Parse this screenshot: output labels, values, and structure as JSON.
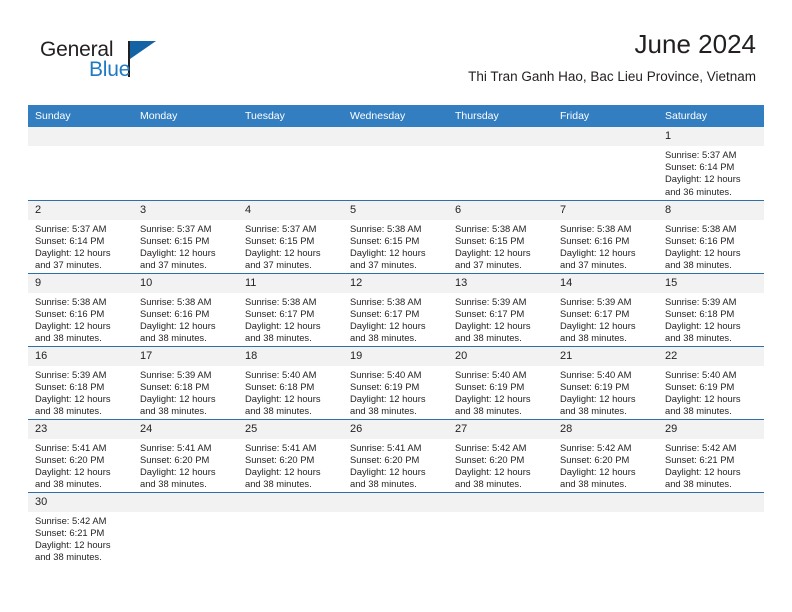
{
  "brand": {
    "name_part1": "General",
    "name_part2": "Blue"
  },
  "header": {
    "title": "June 2024",
    "subtitle": "Thi Tran Ganh Hao, Bac Lieu Province, Vietnam"
  },
  "colors": {
    "header_blue": "#337ec0",
    "row_divider": "#2f6fa8",
    "daynum_band": "#f2f2f2",
    "brand_blue": "#1f7ac4",
    "text": "#231f20"
  },
  "weekdays": [
    "Sunday",
    "Monday",
    "Tuesday",
    "Wednesday",
    "Thursday",
    "Friday",
    "Saturday"
  ],
  "labels": {
    "sunrise": "Sunrise:",
    "sunset": "Sunset:",
    "daylight": "Daylight:"
  },
  "weeks": [
    [
      {
        "day": "",
        "empty": true
      },
      {
        "day": "",
        "empty": true
      },
      {
        "day": "",
        "empty": true
      },
      {
        "day": "",
        "empty": true
      },
      {
        "day": "",
        "empty": true
      },
      {
        "day": "",
        "empty": true
      },
      {
        "day": "1",
        "sunrise": "Sunrise: 5:37 AM",
        "sunset": "Sunset: 6:14 PM",
        "daylight_l1": "Daylight: 12 hours",
        "daylight_l2": "and 36 minutes."
      }
    ],
    [
      {
        "day": "2",
        "sunrise": "Sunrise: 5:37 AM",
        "sunset": "Sunset: 6:14 PM",
        "daylight_l1": "Daylight: 12 hours",
        "daylight_l2": "and 37 minutes."
      },
      {
        "day": "3",
        "sunrise": "Sunrise: 5:37 AM",
        "sunset": "Sunset: 6:15 PM",
        "daylight_l1": "Daylight: 12 hours",
        "daylight_l2": "and 37 minutes."
      },
      {
        "day": "4",
        "sunrise": "Sunrise: 5:37 AM",
        "sunset": "Sunset: 6:15 PM",
        "daylight_l1": "Daylight: 12 hours",
        "daylight_l2": "and 37 minutes."
      },
      {
        "day": "5",
        "sunrise": "Sunrise: 5:38 AM",
        "sunset": "Sunset: 6:15 PM",
        "daylight_l1": "Daylight: 12 hours",
        "daylight_l2": "and 37 minutes."
      },
      {
        "day": "6",
        "sunrise": "Sunrise: 5:38 AM",
        "sunset": "Sunset: 6:15 PM",
        "daylight_l1": "Daylight: 12 hours",
        "daylight_l2": "and 37 minutes."
      },
      {
        "day": "7",
        "sunrise": "Sunrise: 5:38 AM",
        "sunset": "Sunset: 6:16 PM",
        "daylight_l1": "Daylight: 12 hours",
        "daylight_l2": "and 37 minutes."
      },
      {
        "day": "8",
        "sunrise": "Sunrise: 5:38 AM",
        "sunset": "Sunset: 6:16 PM",
        "daylight_l1": "Daylight: 12 hours",
        "daylight_l2": "and 38 minutes."
      }
    ],
    [
      {
        "day": "9",
        "sunrise": "Sunrise: 5:38 AM",
        "sunset": "Sunset: 6:16 PM",
        "daylight_l1": "Daylight: 12 hours",
        "daylight_l2": "and 38 minutes."
      },
      {
        "day": "10",
        "sunrise": "Sunrise: 5:38 AM",
        "sunset": "Sunset: 6:16 PM",
        "daylight_l1": "Daylight: 12 hours",
        "daylight_l2": "and 38 minutes."
      },
      {
        "day": "11",
        "sunrise": "Sunrise: 5:38 AM",
        "sunset": "Sunset: 6:17 PM",
        "daylight_l1": "Daylight: 12 hours",
        "daylight_l2": "and 38 minutes."
      },
      {
        "day": "12",
        "sunrise": "Sunrise: 5:38 AM",
        "sunset": "Sunset: 6:17 PM",
        "daylight_l1": "Daylight: 12 hours",
        "daylight_l2": "and 38 minutes."
      },
      {
        "day": "13",
        "sunrise": "Sunrise: 5:39 AM",
        "sunset": "Sunset: 6:17 PM",
        "daylight_l1": "Daylight: 12 hours",
        "daylight_l2": "and 38 minutes."
      },
      {
        "day": "14",
        "sunrise": "Sunrise: 5:39 AM",
        "sunset": "Sunset: 6:17 PM",
        "daylight_l1": "Daylight: 12 hours",
        "daylight_l2": "and 38 minutes."
      },
      {
        "day": "15",
        "sunrise": "Sunrise: 5:39 AM",
        "sunset": "Sunset: 6:18 PM",
        "daylight_l1": "Daylight: 12 hours",
        "daylight_l2": "and 38 minutes."
      }
    ],
    [
      {
        "day": "16",
        "sunrise": "Sunrise: 5:39 AM",
        "sunset": "Sunset: 6:18 PM",
        "daylight_l1": "Daylight: 12 hours",
        "daylight_l2": "and 38 minutes."
      },
      {
        "day": "17",
        "sunrise": "Sunrise: 5:39 AM",
        "sunset": "Sunset: 6:18 PM",
        "daylight_l1": "Daylight: 12 hours",
        "daylight_l2": "and 38 minutes."
      },
      {
        "day": "18",
        "sunrise": "Sunrise: 5:40 AM",
        "sunset": "Sunset: 6:18 PM",
        "daylight_l1": "Daylight: 12 hours",
        "daylight_l2": "and 38 minutes."
      },
      {
        "day": "19",
        "sunrise": "Sunrise: 5:40 AM",
        "sunset": "Sunset: 6:19 PM",
        "daylight_l1": "Daylight: 12 hours",
        "daylight_l2": "and 38 minutes."
      },
      {
        "day": "20",
        "sunrise": "Sunrise: 5:40 AM",
        "sunset": "Sunset: 6:19 PM",
        "daylight_l1": "Daylight: 12 hours",
        "daylight_l2": "and 38 minutes."
      },
      {
        "day": "21",
        "sunrise": "Sunrise: 5:40 AM",
        "sunset": "Sunset: 6:19 PM",
        "daylight_l1": "Daylight: 12 hours",
        "daylight_l2": "and 38 minutes."
      },
      {
        "day": "22",
        "sunrise": "Sunrise: 5:40 AM",
        "sunset": "Sunset: 6:19 PM",
        "daylight_l1": "Daylight: 12 hours",
        "daylight_l2": "and 38 minutes."
      }
    ],
    [
      {
        "day": "23",
        "sunrise": "Sunrise: 5:41 AM",
        "sunset": "Sunset: 6:20 PM",
        "daylight_l1": "Daylight: 12 hours",
        "daylight_l2": "and 38 minutes."
      },
      {
        "day": "24",
        "sunrise": "Sunrise: 5:41 AM",
        "sunset": "Sunset: 6:20 PM",
        "daylight_l1": "Daylight: 12 hours",
        "daylight_l2": "and 38 minutes."
      },
      {
        "day": "25",
        "sunrise": "Sunrise: 5:41 AM",
        "sunset": "Sunset: 6:20 PM",
        "daylight_l1": "Daylight: 12 hours",
        "daylight_l2": "and 38 minutes."
      },
      {
        "day": "26",
        "sunrise": "Sunrise: 5:41 AM",
        "sunset": "Sunset: 6:20 PM",
        "daylight_l1": "Daylight: 12 hours",
        "daylight_l2": "and 38 minutes."
      },
      {
        "day": "27",
        "sunrise": "Sunrise: 5:42 AM",
        "sunset": "Sunset: 6:20 PM",
        "daylight_l1": "Daylight: 12 hours",
        "daylight_l2": "and 38 minutes."
      },
      {
        "day": "28",
        "sunrise": "Sunrise: 5:42 AM",
        "sunset": "Sunset: 6:20 PM",
        "daylight_l1": "Daylight: 12 hours",
        "daylight_l2": "and 38 minutes."
      },
      {
        "day": "29",
        "sunrise": "Sunrise: 5:42 AM",
        "sunset": "Sunset: 6:21 PM",
        "daylight_l1": "Daylight: 12 hours",
        "daylight_l2": "and 38 minutes."
      }
    ],
    [
      {
        "day": "30",
        "sunrise": "Sunrise: 5:42 AM",
        "sunset": "Sunset: 6:21 PM",
        "daylight_l1": "Daylight: 12 hours",
        "daylight_l2": "and 38 minutes."
      },
      {
        "day": "",
        "empty": true
      },
      {
        "day": "",
        "empty": true
      },
      {
        "day": "",
        "empty": true
      },
      {
        "day": "",
        "empty": true
      },
      {
        "day": "",
        "empty": true
      },
      {
        "day": "",
        "empty": true
      }
    ]
  ]
}
